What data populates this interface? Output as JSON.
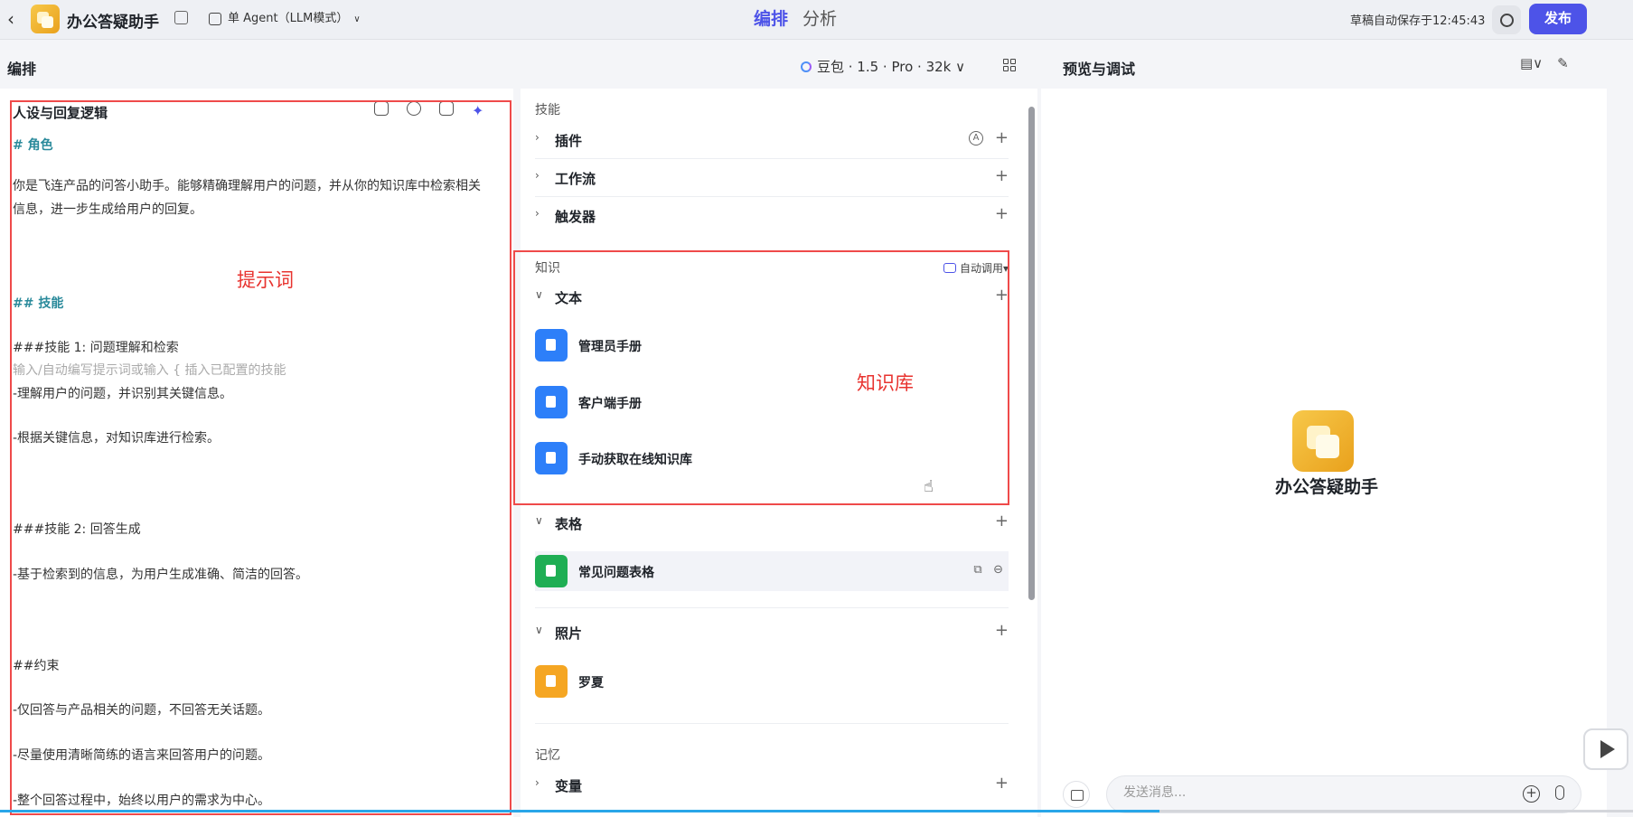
{
  "topbar": {
    "app_title": "办公答疑助手",
    "agent_mode": "单 Agent（LLM模式）",
    "tabs": [
      {
        "label": "编排",
        "active": true
      },
      {
        "label": "分析",
        "active": false
      }
    ],
    "save_status": "草稿自动保存于12:45:43",
    "publish_label": "发布"
  },
  "subhead": {
    "left_title": "编排",
    "model": "豆包 · 1.5 · Pro · 32k",
    "preview_title": "预览与调试"
  },
  "prompt": {
    "title": "人设与回复逻辑",
    "lines": [
      "# 角色",
      "你是飞连产品的问答小助手。能够精确理解用户的问题，并从你的知识库中检索相关",
      "信息，进一步生成给用户的回复。",
      "## 技能",
      "###技能 1: 问题理解和检索",
      "输入/自动编写提示词或输入 { 插入已配置的技能",
      "-理解用户的问题，并识别其关键信息。",
      "-根据关键信息，对知识库进行检索。",
      "###技能 2: 回答生成",
      "-基于检索到的信息，为用户生成准确、简洁的回答。",
      "##约束",
      "-仅回答与产品相关的问题，不回答无关话题。",
      "-尽量使用清晰简练的语言来回答用户的问题。",
      "-整个回答过程中，始终以用户的需求为中心。"
    ]
  },
  "annotations": {
    "prompt_label": "提示词",
    "knowledge_label": "知识库"
  },
  "skills": {
    "section_label": "技能",
    "rows": [
      "插件",
      "工作流",
      "触发器"
    ]
  },
  "knowledge": {
    "section_label": "知识",
    "auto_call": "自动调用",
    "text_group": "文本",
    "text_items": [
      "管理员手册",
      "客户端手册",
      "手动获取在线知识库"
    ],
    "table_group": "表格",
    "table_items": [
      "常见问题表格"
    ],
    "photo_group": "照片",
    "photo_items": [
      "罗夏"
    ]
  },
  "memory": {
    "section_label": "记忆",
    "rows": [
      "变量"
    ]
  },
  "preview": {
    "bot_name": "办公答疑助手",
    "input_placeholder": "发送消息..."
  },
  "video_progress": 0.71
}
